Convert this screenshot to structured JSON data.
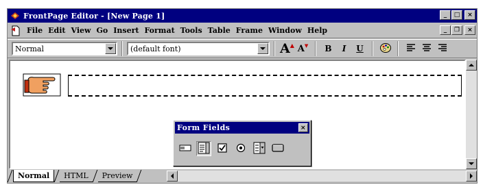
{
  "window": {
    "title": "FrontPage Editor - [New Page 1]",
    "controls": {
      "minimize": "_",
      "maximize": "□",
      "close": "×"
    }
  },
  "menubar": {
    "items": [
      {
        "label": "File"
      },
      {
        "label": "Edit"
      },
      {
        "label": "View"
      },
      {
        "label": "Go"
      },
      {
        "label": "Insert"
      },
      {
        "label": "Format"
      },
      {
        "label": "Tools"
      },
      {
        "label": "Table"
      },
      {
        "label": "Frame"
      },
      {
        "label": "Window"
      },
      {
        "label": "Help"
      }
    ],
    "mdi_controls": {
      "minimize": "_",
      "restore": "❐",
      "close": "×"
    }
  },
  "toolbar": {
    "style_value": "Normal",
    "font_value": "(default font)",
    "increase_font_label": "A",
    "decrease_font_label": "A",
    "bold_label": "B",
    "italic_label": "I",
    "underline_label": "U"
  },
  "view_tabs": [
    {
      "label": "Normal",
      "active": true
    },
    {
      "label": "HTML",
      "active": false
    },
    {
      "label": "Preview",
      "active": false
    }
  ],
  "form_fields_toolbar": {
    "title": "Form Fields",
    "close": "×",
    "tools": [
      {
        "icon": "one-line-textbox-icon"
      },
      {
        "icon": "scrolling-textbox-icon"
      },
      {
        "icon": "checkbox-icon"
      },
      {
        "icon": "radio-button-icon"
      },
      {
        "icon": "dropdown-menu-icon"
      },
      {
        "icon": "push-button-icon"
      }
    ]
  },
  "colors": {
    "title_bar": "#000080",
    "chrome": "#c0c0c0",
    "document": "#ffffff"
  }
}
